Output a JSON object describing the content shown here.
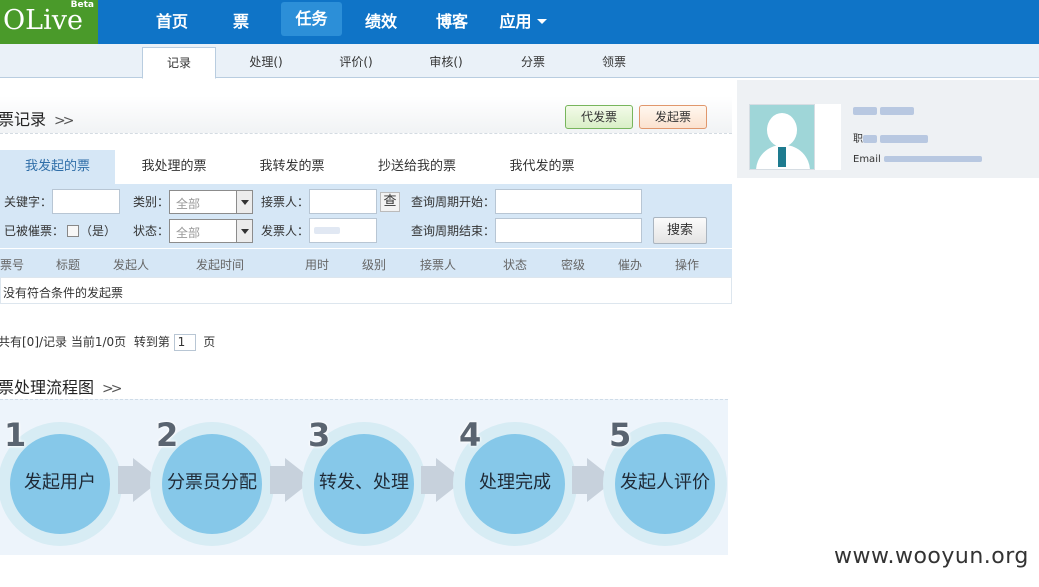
{
  "logo": {
    "text": "OLive",
    "badge": "Beta"
  },
  "nav": {
    "items": [
      {
        "label": "首页"
      },
      {
        "label": "票"
      },
      {
        "label": "任务"
      },
      {
        "label": "绩效"
      },
      {
        "label": "博客"
      },
      {
        "label": "应用"
      }
    ]
  },
  "subnav": {
    "items": [
      {
        "label": "记录"
      },
      {
        "label": "处理()"
      },
      {
        "label": "评价()"
      },
      {
        "label": "审核()"
      },
      {
        "label": "分票"
      },
      {
        "label": "领票"
      }
    ]
  },
  "section": {
    "title": "票记录",
    "chevrons": ">>",
    "proxy_button": "代发票",
    "create_button": "发起票"
  },
  "profile": {
    "line2_prefix": "职",
    "line3_prefix": "Email"
  },
  "tabs": [
    {
      "label": "我发起的票"
    },
    {
      "label": "我处理的票"
    },
    {
      "label": "我转发的票"
    },
    {
      "label": "抄送给我的票"
    },
    {
      "label": "我代发的票"
    }
  ],
  "filter": {
    "keyword_label": "关键字：",
    "category_label": "类别：",
    "category_value": "全部",
    "receiver_label": "接票人：",
    "lookup_button": "查",
    "period_start_label": "查询周期开始：",
    "urged_label": "已被催票：",
    "urged_option": "（是）",
    "status_label": "状态：",
    "status_value": "全部",
    "sender_label": "发票人：",
    "period_end_label": "查询周期结束：",
    "search_button": "搜索"
  },
  "table": {
    "columns": [
      "票号",
      "标题",
      "发起人",
      "发起时间",
      "用时",
      "级别",
      "接票人",
      "状态",
      "密级",
      "催办",
      "操作"
    ],
    "empty_message": "没有符合条件的发起票"
  },
  "pager": {
    "total_text": "共有[0]/记录 当前1/0页",
    "goto_text": "转到第",
    "page_value": "1",
    "page_suffix": "页"
  },
  "flow": {
    "title": "票处理流程图",
    "chevrons": ">>",
    "steps": [
      {
        "num": "1",
        "label": "发起用户"
      },
      {
        "num": "2",
        "label": "分票员分配"
      },
      {
        "num": "3",
        "label": "转发、处理"
      },
      {
        "num": "4",
        "label": "处理完成"
      },
      {
        "num": "5",
        "label": "发起人评价"
      }
    ]
  },
  "watermark": "www.wooyun.org",
  "colors": {
    "nav_bg": "#0f74c7",
    "logo_bg": "#4a9a2a",
    "tab_active_bg": "#d6e7f6",
    "step_circle": "#86c8e9"
  }
}
